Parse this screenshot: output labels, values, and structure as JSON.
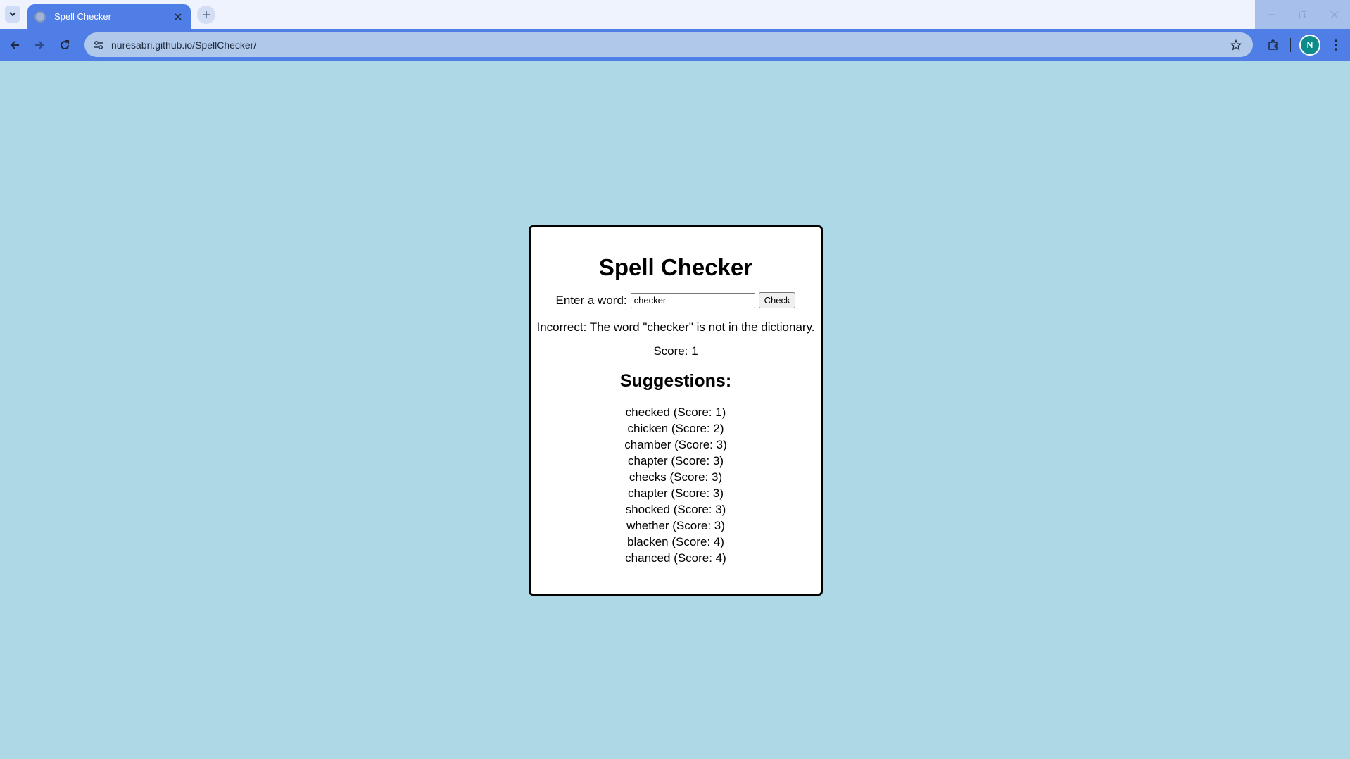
{
  "browser": {
    "tab_title": "Spell Checker",
    "url": "nuresabri.github.io/SpellChecker/",
    "profile_initial": "N"
  },
  "app": {
    "title": "Spell Checker",
    "input_label": "Enter a word:",
    "input_value": "checker",
    "check_button": "Check",
    "result_message": "Incorrect: The word \"checker\" is not in the dictionary.",
    "score_text": "Score: 1",
    "suggestions_title": "Suggestions:",
    "suggestions": [
      "checked (Score: 1)",
      "chicken (Score: 2)",
      "chamber (Score: 3)",
      "chapter (Score: 3)",
      "checks (Score: 3)",
      "chapter (Score: 3)",
      "shocked (Score: 3)",
      "whether (Score: 3)",
      "blacken (Score: 4)",
      "chanced (Score: 4)"
    ]
  },
  "colors": {
    "page_background": "#add8e6",
    "browser_accent": "#4f7ee6",
    "card_background": "#ffffff",
    "card_border": "#000000"
  }
}
